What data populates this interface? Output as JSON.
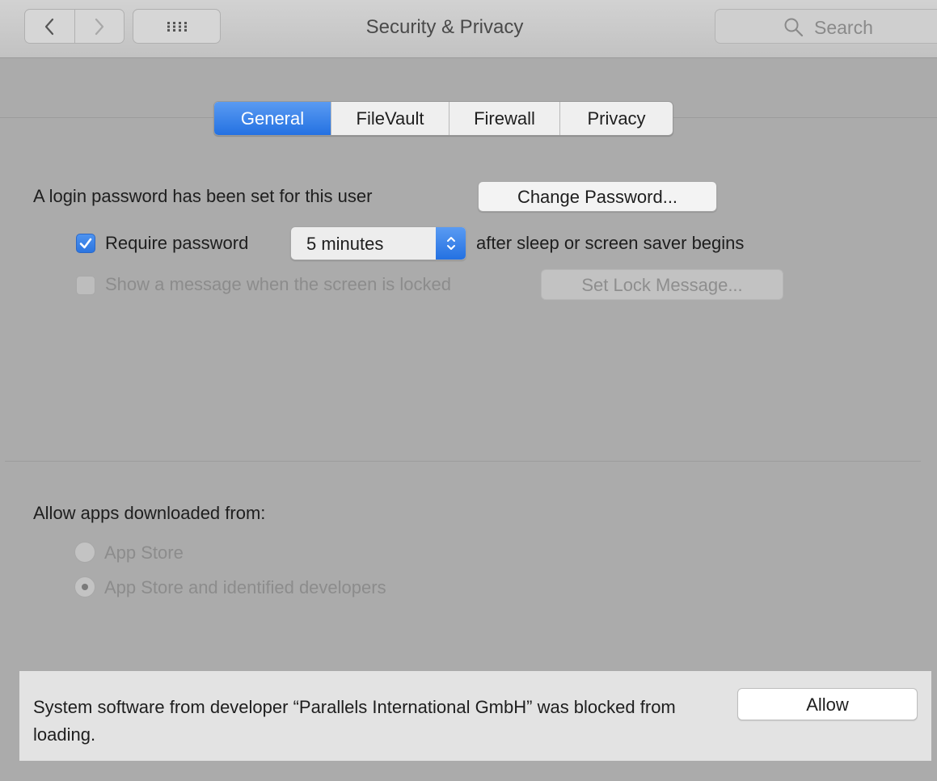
{
  "window": {
    "title": "Security & Privacy"
  },
  "toolbar": {
    "back_icon": "chevron-left-icon",
    "forward_icon": "chevron-right-icon",
    "grid_icon": "grid-icon",
    "search": {
      "placeholder": "Search",
      "icon": "search-icon"
    }
  },
  "tabs": [
    {
      "label": "General",
      "active": true
    },
    {
      "label": "FileVault",
      "active": false
    },
    {
      "label": "Firewall",
      "active": false
    },
    {
      "label": "Privacy",
      "active": false
    }
  ],
  "general": {
    "login_text": "A login password has been set for this user",
    "change_password_label": "Change Password...",
    "require_password": {
      "checked": true,
      "label": "Require password",
      "delay_value": "5 minutes",
      "suffix": "after sleep or screen saver begins"
    },
    "show_message": {
      "checked": false,
      "label": "Show a message when the screen is locked",
      "button_label": "Set Lock Message..."
    }
  },
  "allow_apps": {
    "heading": "Allow apps downloaded from:",
    "options": [
      {
        "label": "App Store",
        "selected": false
      },
      {
        "label": "App Store and identified developers",
        "selected": true
      }
    ]
  },
  "notice": {
    "text": "System software from developer “Parallels International GmbH” was blocked from loading.",
    "button_label": "Allow"
  },
  "colors": {
    "accent": "#2b76e5",
    "window_bg": "#ababab",
    "notice_bg": "#e3e3e3"
  }
}
